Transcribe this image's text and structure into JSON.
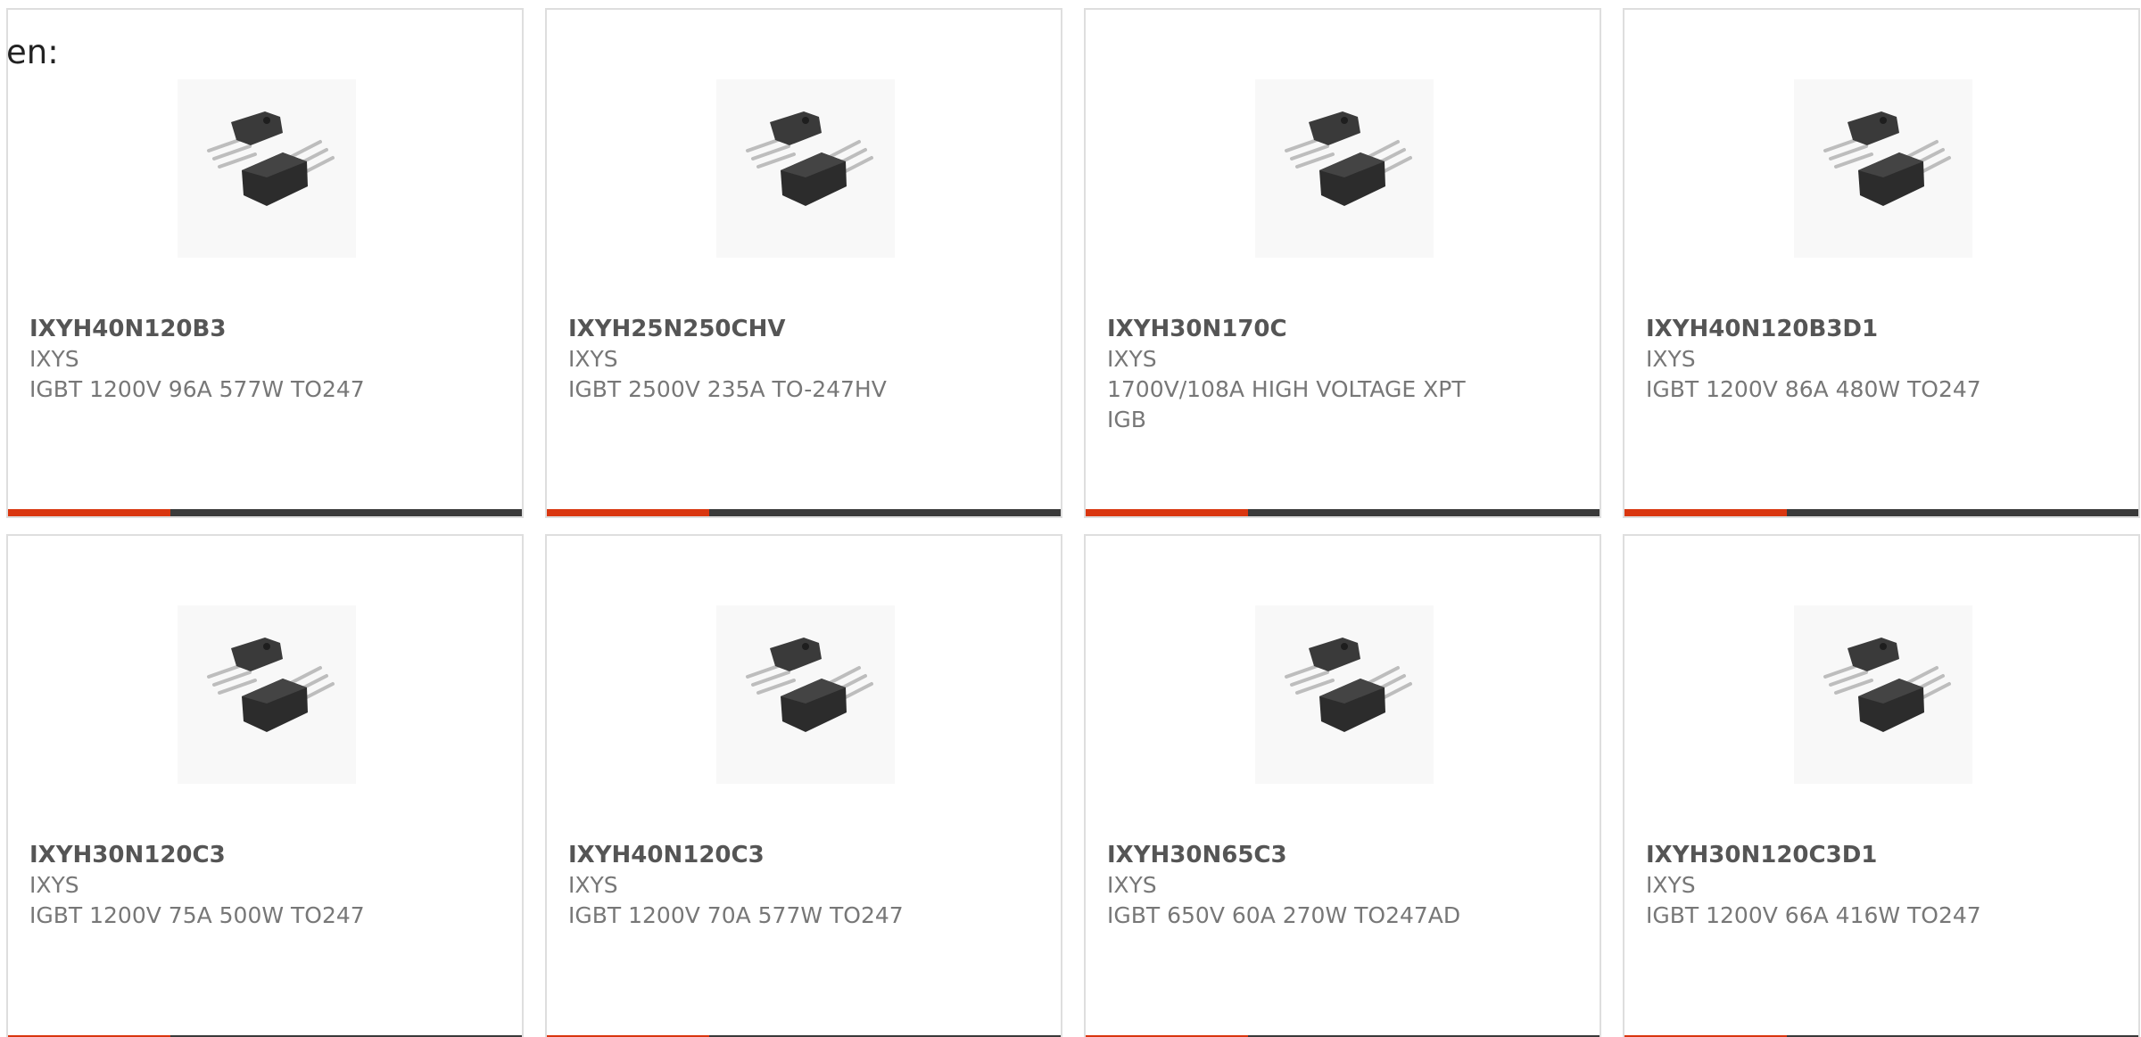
{
  "page": {
    "fragment_text": "en:"
  },
  "products": [
    {
      "part_number": "IXYH40N120B3",
      "manufacturer": "IXYS",
      "description": "IGBT 1200V 96A 577W TO247"
    },
    {
      "part_number": "IXYH25N250CHV",
      "manufacturer": "IXYS",
      "description": "IGBT 2500V 235A TO-247HV"
    },
    {
      "part_number": "IXYH30N170C",
      "manufacturer": "IXYS",
      "description": "1700V/108A HIGH VOLTAGE XPT IGB"
    },
    {
      "part_number": "IXYH40N120B3D1",
      "manufacturer": "IXYS",
      "description": "IGBT 1200V 86A 480W TO247"
    },
    {
      "part_number": "IXYH30N120C3",
      "manufacturer": "IXYS",
      "description": "IGBT 1200V 75A 500W TO247"
    },
    {
      "part_number": "IXYH40N120C3",
      "manufacturer": "IXYS",
      "description": "IGBT 1200V 70A 577W TO247"
    },
    {
      "part_number": "IXYH30N65C3",
      "manufacturer": "IXYS",
      "description": "IGBT 650V 60A 270W TO247AD"
    },
    {
      "part_number": "IXYH30N120C3D1",
      "manufacturer": "IXYS",
      "description": "IGBT 1200V 66A 416W TO247"
    }
  ],
  "theme": {
    "accent_color": "#d9360f",
    "bar_color": "#3a3a3a",
    "border_color": "#dedede"
  },
  "icons": {
    "product_image": "to247-package-icon"
  }
}
